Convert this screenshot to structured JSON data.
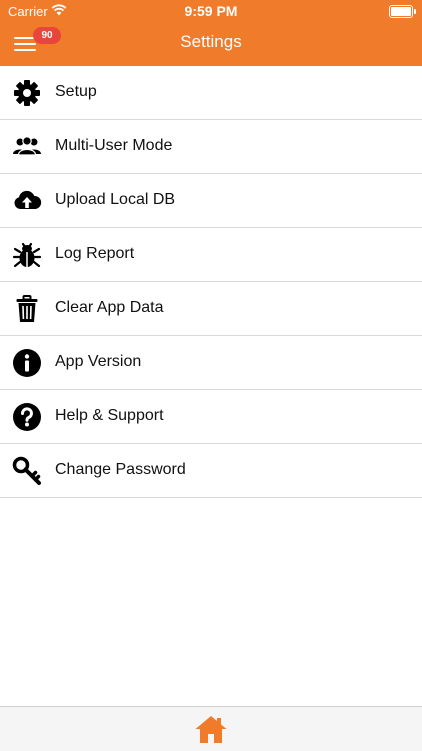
{
  "status_bar": {
    "carrier": "Carrier",
    "time": "9:59 PM"
  },
  "header": {
    "title": "Settings",
    "badge_count": "90"
  },
  "menu": {
    "items": [
      {
        "label": "Setup",
        "icon": "gear-icon"
      },
      {
        "label": "Multi-User Mode",
        "icon": "users-icon"
      },
      {
        "label": "Upload Local DB",
        "icon": "cloud-upload-icon"
      },
      {
        "label": "Log Report",
        "icon": "bug-icon"
      },
      {
        "label": "Clear App Data",
        "icon": "trash-icon"
      },
      {
        "label": "App Version",
        "icon": "info-icon"
      },
      {
        "label": "Help & Support",
        "icon": "question-icon"
      },
      {
        "label": "Change Password",
        "icon": "key-icon"
      }
    ]
  },
  "tabbar": {
    "home_icon": "home-icon"
  },
  "colors": {
    "accent": "#f07b2a",
    "badge": "#e8453c",
    "text": "#111111",
    "divider": "#d9d9d9"
  }
}
